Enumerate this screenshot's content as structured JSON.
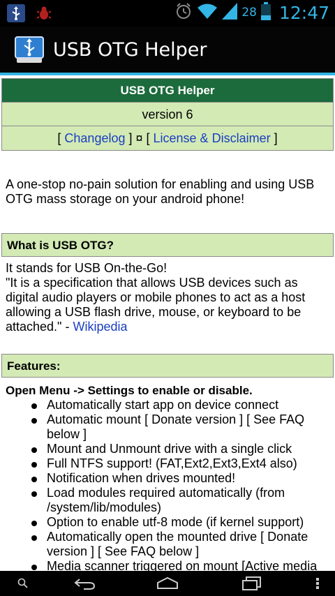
{
  "status_bar": {
    "battery_percent": "28",
    "time": "12:47",
    "notification_icons": [
      "usb-icon",
      "bug-icon"
    ],
    "system_icons": [
      "alarm-icon",
      "wifi-icon",
      "signal-icon",
      "battery-icon"
    ]
  },
  "action_bar": {
    "title": "USB OTG Helper",
    "icon": "usb-drive-icon"
  },
  "header": {
    "title": "USB OTG Helper",
    "version": "version 6",
    "open_bracket_1": "[ ",
    "changelog_link": "Changelog",
    "separator": " ] ¤ [ ",
    "license_link": "License & Disclaimer",
    "close_bracket_2": " ]"
  },
  "intro": "A one-stop no-pain solution for enabling and using USB OTG mass storage on your android phone!",
  "what_is": {
    "heading": "What is USB OTG?",
    "line1": "It stands for USB On-the-Go!",
    "quote": "\"It is a specification that allows USB devices such as digital audio players or mobile phones to act as a host allowing a USB flash drive, mouse, or keyboard to be attached.\" - ",
    "wikipedia_link": "Wikipedia"
  },
  "features": {
    "heading": "Features:",
    "intro": "Open Menu -> Settings to enable or disable.",
    "items": [
      "Automatically start app on device connect",
      "Automatic mount [ Donate version ] [ See FAQ below ]",
      "Mount and Unmount drive with a single click",
      "Full NTFS support! (FAT,Ext2,Ext3,Ext4 also)",
      "Notification when drives mounted!",
      "Load modules required automatically (from /system/lib/modules)",
      "Option to enable utf-8 mode (if kernel support)",
      "Automatically open the mounted drive [ Donate version ] [ See FAQ below ]",
      "Media scanner triggered on mount [Active media"
    ]
  },
  "nav_bar": {
    "buttons": [
      "search-icon",
      "back-icon",
      "home-icon",
      "recent-apps-icon",
      "menu-icon"
    ]
  },
  "colors": {
    "accent": "#33b5e5",
    "header_green": "#1c6b3c",
    "light_green": "#d3eab5",
    "link": "#1a3fbf"
  }
}
